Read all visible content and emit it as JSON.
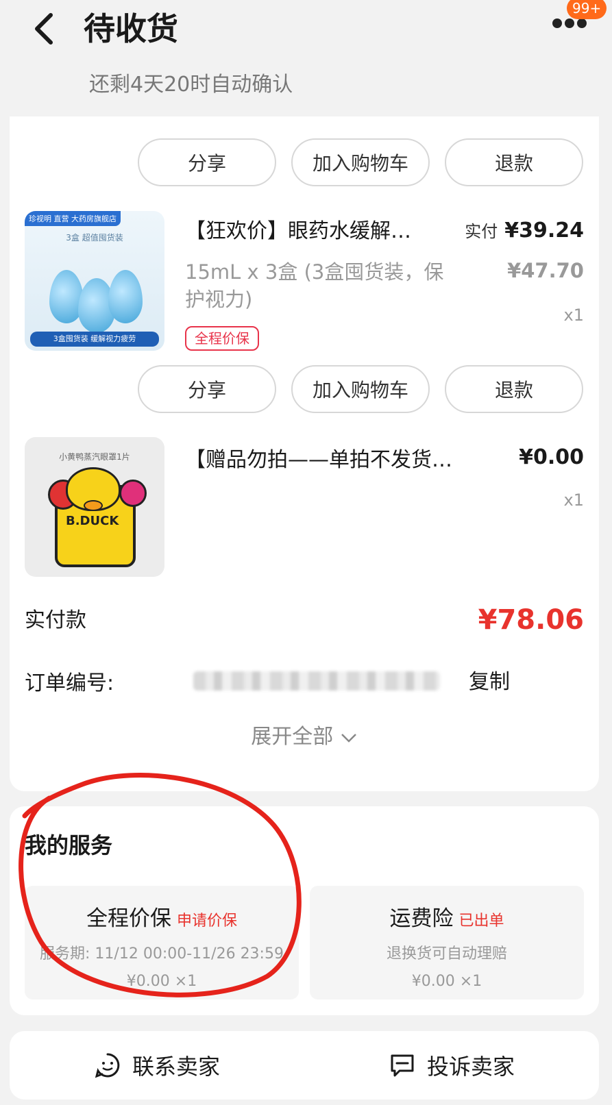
{
  "header": {
    "title": "待收货",
    "subtitle": "还剩4天20时自动确认",
    "badge": "99+"
  },
  "actions": {
    "share": "分享",
    "add_to_cart": "加入购物车",
    "refund": "退款"
  },
  "products": [
    {
      "name": "【狂欢价】眼药水缓解…",
      "spec": "15mL x 3盒 (3盒囤货装，保护视力)",
      "tag": "全程价保",
      "paid_label": "实付",
      "paid_price": "¥39.24",
      "original_price": "¥47.70",
      "qty": "x1",
      "image": {
        "brand_tag": "珍视明 直营 大药房旗舰店",
        "top_text": "3盒 超值囤货装",
        "bottom_text": "3盒囤货装 缓解视力疲劳"
      }
    },
    {
      "name": "【赠品勿拍——单拍不发货…",
      "price": "¥0.00",
      "qty": "x1",
      "image": {
        "top_text": "小黄鸭蒸汽眼罩1片",
        "logo_text": "B.DUCK"
      }
    }
  ],
  "summary": {
    "paid_label": "实付款",
    "paid_total": "¥78.06",
    "order_no_label": "订单编号:",
    "copy_label": "复制",
    "expand_label": "展开全部"
  },
  "services": {
    "title": "我的服务",
    "items": [
      {
        "name": "全程价保",
        "action": "申请价保",
        "desc": "服务期: 11/12 00:00-11/26 23:59",
        "amount": "¥0.00 ×1"
      },
      {
        "name": "运费险",
        "action": "已出单",
        "desc": "退换货可自动理赔",
        "amount": "¥0.00 ×1"
      }
    ]
  },
  "bottom": {
    "contact": "联系卖家",
    "complain": "投诉卖家"
  },
  "colors": {
    "accent_red": "#e8332d",
    "badge_orange": "#ff6a1a",
    "annotation_red": "#e5231b"
  },
  "icons": [
    "back-arrow-icon",
    "more-dots-icon",
    "smile-chat-icon",
    "complaint-icon",
    "chevron-down-icon"
  ]
}
